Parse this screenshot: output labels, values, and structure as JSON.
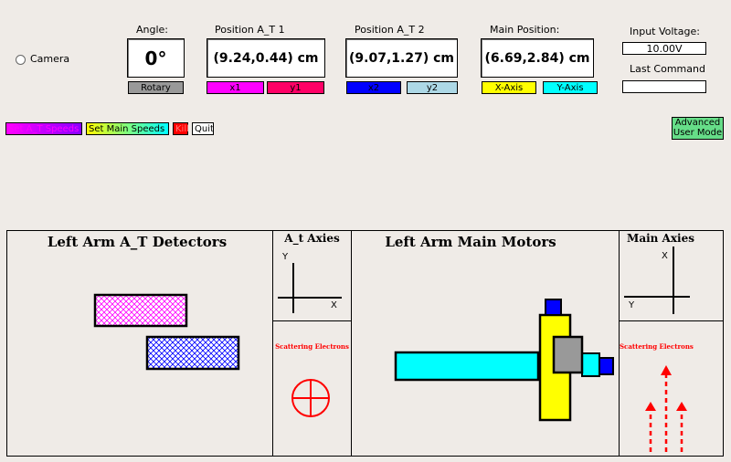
{
  "camera": {
    "label": "Camera"
  },
  "angle": {
    "title": "Angle:",
    "value": "0°",
    "tag": "Rotary"
  },
  "position_at1": {
    "title": "Position A_T 1",
    "value": "(9.24,0.44) cm",
    "tag_x": "x1",
    "tag_y": "y1"
  },
  "position_at2": {
    "title": "Position A_T 2",
    "value": "(9.07,1.27) cm",
    "tag_x": "x2",
    "tag_y": "y2"
  },
  "main_position": {
    "title": "Main Position:",
    "value": "(6.69,2.84) cm",
    "tag_x": "X-Axis",
    "tag_y": "Y-Axis"
  },
  "voltage": {
    "title": "Input Voltage:",
    "value": "10.00V"
  },
  "last_command": {
    "title": "Last Command",
    "value": ""
  },
  "buttons": {
    "set_at_speeds": "Set A_T Speeds",
    "set_main_speeds": "Set Main Speeds",
    "kill": "Kill",
    "quit": "Quit",
    "advanced_1": "Advanced",
    "advanced_2": "User Mode"
  },
  "panels": {
    "left_detectors_title": "Left Arm A_T Detectors",
    "at_axes_title": "A_t Axies",
    "at_axis_y": "Y",
    "at_axis_x": "X",
    "at_scattering": "Scattering Electrons",
    "main_motors_title": "Left Arm Main Motors",
    "main_axes_title": "Main Axies",
    "main_axis_x": "X",
    "main_axis_y": "Y",
    "main_scattering": "Scattering Electrons"
  },
  "colors": {
    "background": "#efebe7",
    "magenta": "#ff00ff",
    "crimson": "#ff0066",
    "blue": "#0000ff",
    "light_blue": "#add8e6",
    "yellow": "#ffff00",
    "cyan": "#00ffff",
    "gray": "#999999",
    "red": "#ff0000",
    "green": "#66dd88",
    "purple": "#8800ff"
  }
}
